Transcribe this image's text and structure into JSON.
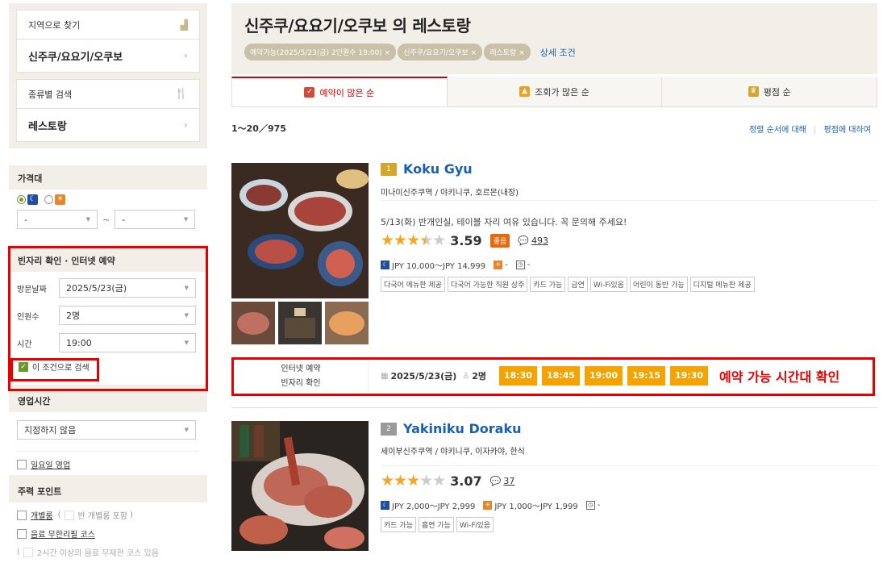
{
  "sidebar": {
    "area_label": "지역으로 찾기",
    "area_value": "신주쿠/요요기/오쿠보",
    "genre_label": "종류별 검색",
    "genre_value": "레스토랑"
  },
  "filters": {
    "price_label": "가격대",
    "price_min": "-",
    "price_max": "-",
    "tilde": "~",
    "booking_label": "빈자리 확인 · 인터넷 예약",
    "date_label": "방문날짜",
    "date_value": "2025/5/23(금)",
    "people_label": "인원수",
    "people_value": "2명",
    "time_label": "시간",
    "time_value": "19:00",
    "search_with_condition": "이 조건으로 검색",
    "hours_label": "영업시간",
    "hours_value": "지정하지 않음",
    "sunday_open": "일요일 영업",
    "points_label": "주력 포인트",
    "private_room": "개별룸",
    "semi_private": "반 개별룸 포함",
    "all_you_can_drink": "음료 무한리필 코스",
    "more_text": "2시간 이상의 음료 무제한 코스 있음"
  },
  "header": {
    "title": "신주쿠/요요기/오쿠보 의 레스토랑",
    "tags": [
      "예약가능(2025/5/23(금) 2인원수 19:00) ×",
      "신주쿠/요요기/오쿠보 ×",
      "레스토랑 ×"
    ],
    "detail_link": "상세 조건"
  },
  "tabs": [
    "예약이 많은 순",
    "조회가 많은 순",
    "평점 순"
  ],
  "results": {
    "count": "1～20／975",
    "sort_link": "정렬 순서에 대해",
    "rating_link": "평점에 대하여"
  },
  "restaurants": [
    {
      "rank": "1",
      "name": "Koku Gyu",
      "meta": "미나미신주쿠역 / 야키니쿠, 호르몬(내장)",
      "notice": "5/13(화) 반개인실, 테이블 자리 여유 있습니다. 꼭 문의해 주세요!",
      "rating": "3.59",
      "rating_fill": 3.5,
      "badge": "좋음",
      "reviews": "493",
      "dinner_price": "JPY 10,000～JPY 14,999",
      "lunch_price": "-",
      "other_price": "-",
      "features": [
        "다국어 메뉴판 제공",
        "다국어 가능한 직원 상주",
        "카드 가능",
        "금연",
        "Wi-Fi있음",
        "어린이 동반 가능",
        "디지털 메뉴판 제공"
      ],
      "booking_label1": "인터넷 예약",
      "booking_label2": "빈자리 확인",
      "booking_date": "2025/5/23(금)",
      "booking_people": "2명",
      "slots": [
        "18:30",
        "18:45",
        "19:00",
        "19:15",
        "19:30"
      ],
      "annotation": "예약 가능 시간대 확인"
    },
    {
      "rank": "2",
      "name": "Yakiniku Doraku",
      "meta": "세이부신주쿠역 / 야키니쿠, 이자카야, 한식",
      "rating": "3.07",
      "rating_fill": 3.0,
      "reviews": "37",
      "dinner_price": "JPY 2,000～JPY 2,999",
      "lunch_price": "JPY 1,000～JPY 1,999",
      "other_price": "-",
      "features": [
        "카드 가능",
        "흡연 가능",
        "Wi-Fi있음"
      ]
    }
  ]
}
